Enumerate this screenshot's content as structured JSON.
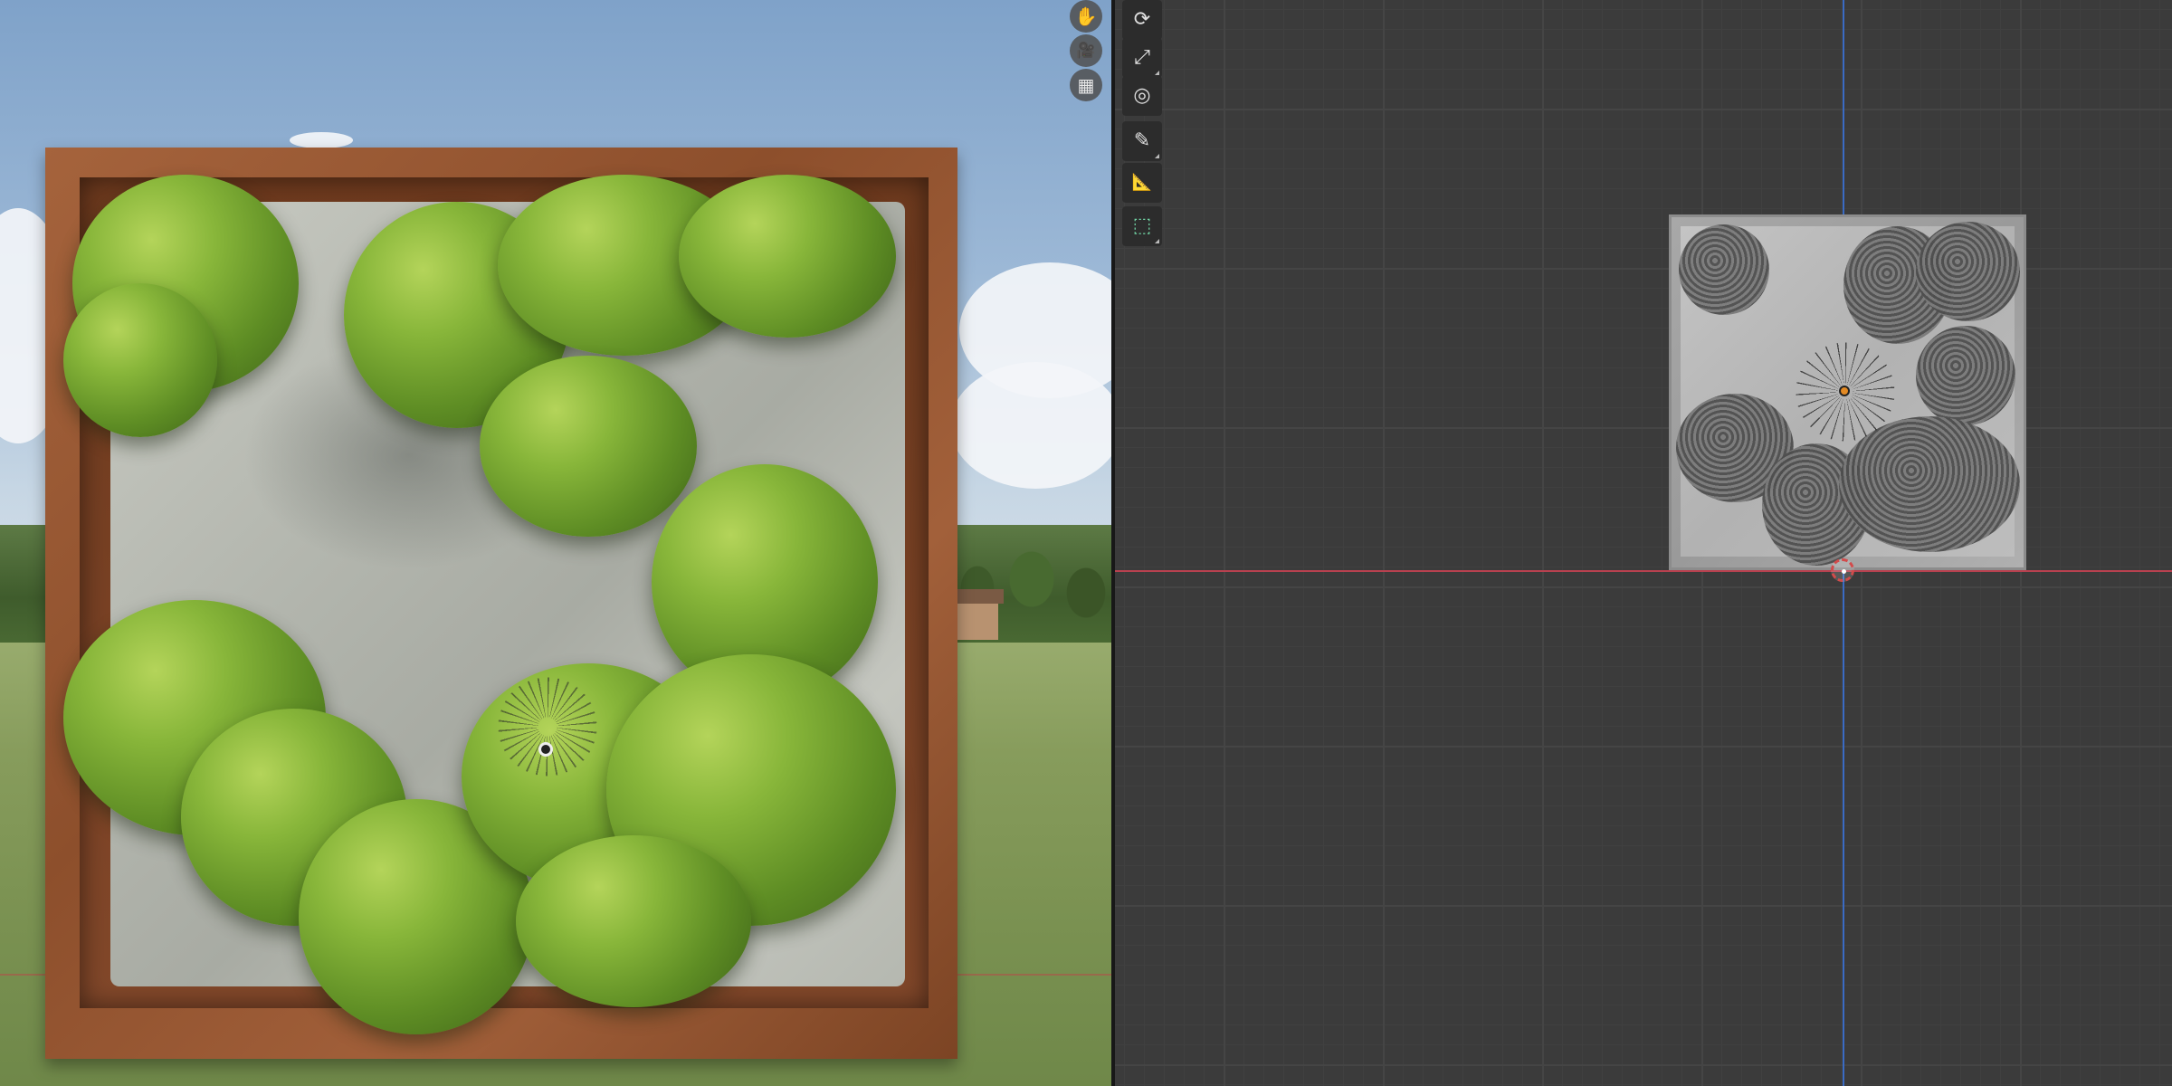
{
  "app": {
    "name": "3D viewport split view"
  },
  "left_viewport": {
    "mode": "rendered",
    "navigation_gizmo": [
      {
        "name": "hand-icon",
        "glyph": "✋"
      },
      {
        "name": "camera-icon",
        "glyph": "🎥"
      },
      {
        "name": "grid-icon",
        "glyph": "▦"
      }
    ]
  },
  "right_viewport": {
    "mode": "top orthographic solid",
    "axis_colors": {
      "x": "#b8414f",
      "y": "#3a6bc4"
    },
    "toolbar": [
      {
        "name": "rotate-tool-icon",
        "glyph": "⟳"
      },
      {
        "name": "scale-tool-icon",
        "glyph": "⤢"
      },
      {
        "name": "transform-tool-icon",
        "glyph": "◎"
      },
      {
        "name": "annotate-tool-icon",
        "glyph": "✎"
      },
      {
        "name": "measure-tool-icon",
        "glyph": "📐"
      },
      {
        "name": "add-cube-tool-icon",
        "glyph": "⬚"
      }
    ]
  }
}
